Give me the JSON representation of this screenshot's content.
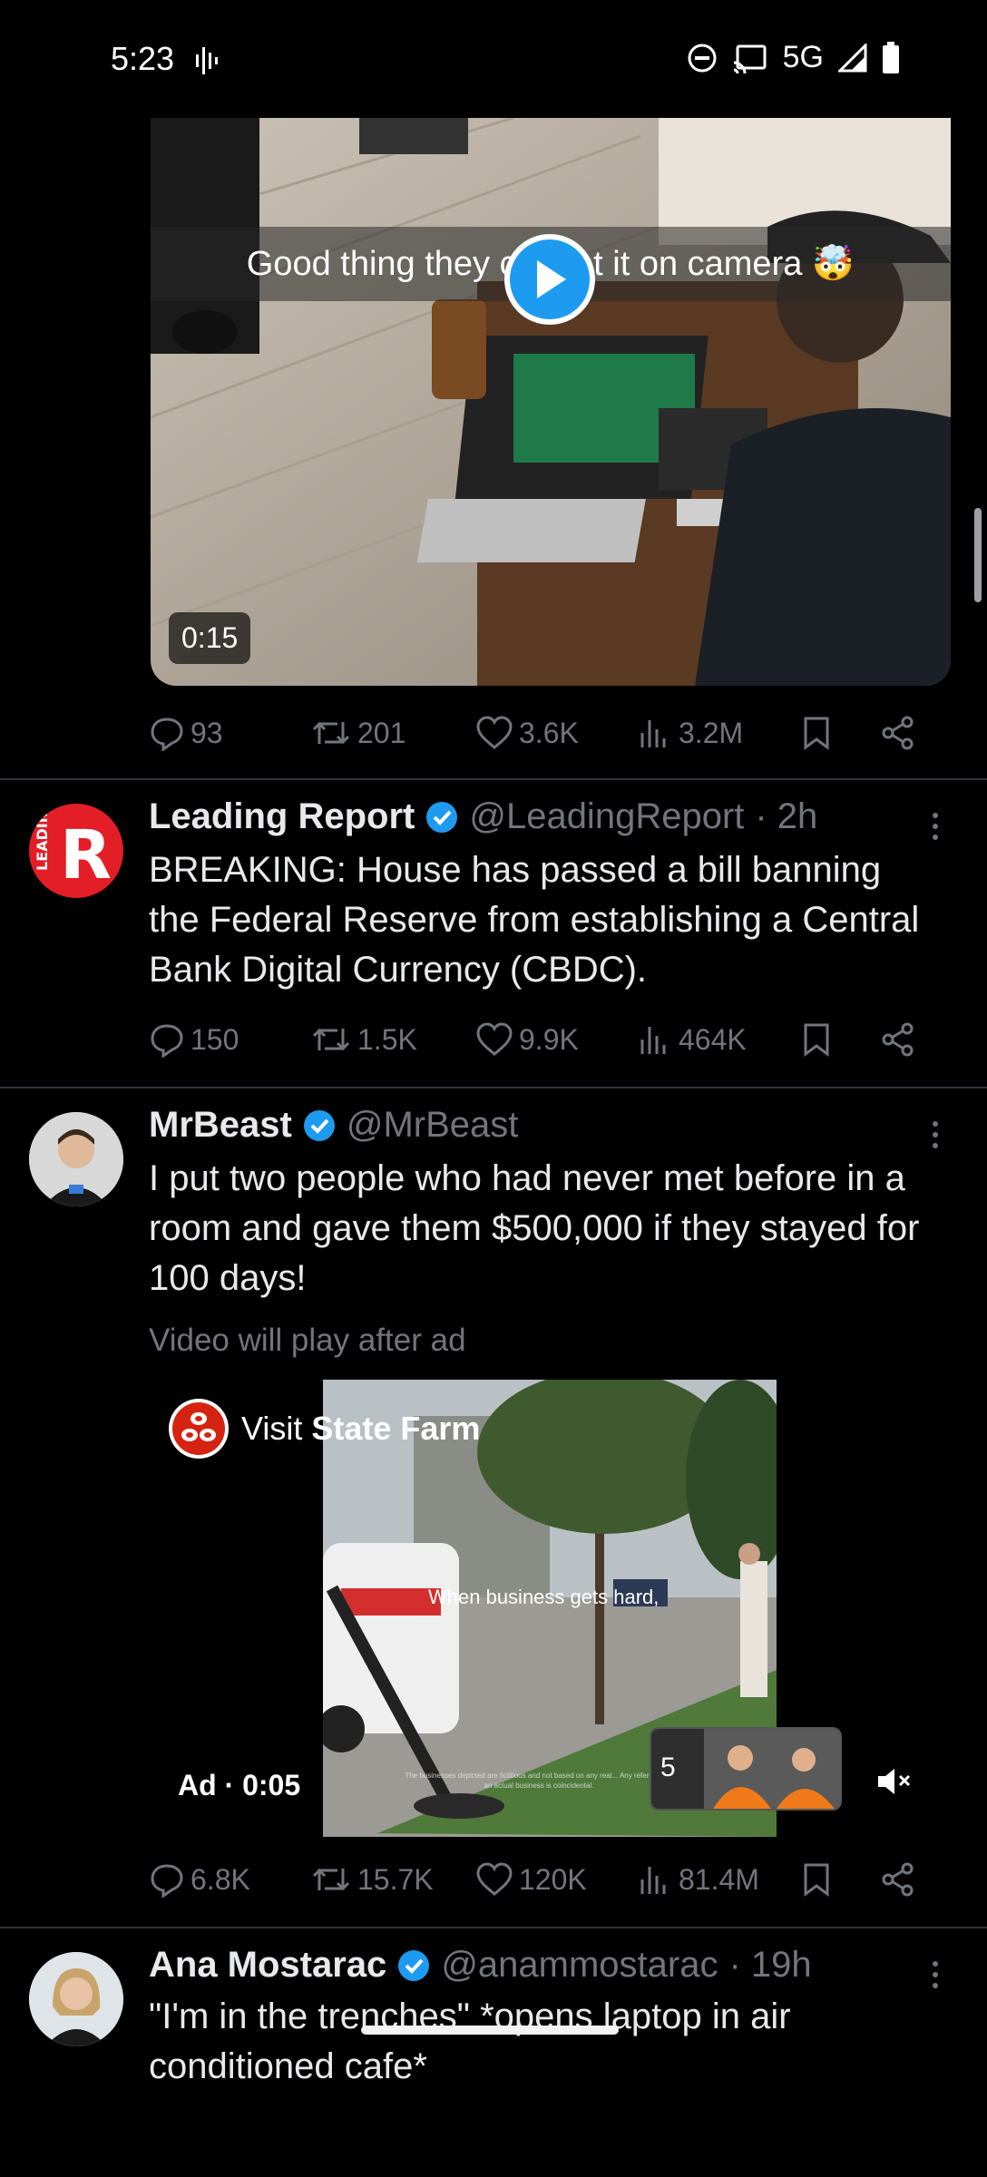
{
  "status_bar": {
    "time": "5:23",
    "network": "5G"
  },
  "tweet1": {
    "video_caption": "Good thing they caught it on camera 🤯",
    "duration": "0:15",
    "replies": "93",
    "retweets": "201",
    "likes": "3.6K",
    "views": "3.2M"
  },
  "tweet2": {
    "display_name": "Leading Report",
    "handle": "@LeadingReport",
    "time": "· 2h",
    "avatar_letter": "R",
    "avatar_side_text": "LEADING",
    "text": "BREAKING: House has passed a bill banning the Federal Reserve from establishing a Central Bank Digital Currency (CBDC).",
    "replies": "150",
    "retweets": "1.5K",
    "likes": "9.9K",
    "views": "464K"
  },
  "tweet3": {
    "display_name": "MrBeast",
    "handle": "@MrBeast",
    "text": "I put two people who had never met before in a room and gave them $500,000 if they stayed for 100 days!",
    "notice": "Video will play after ad",
    "ad_cta_prefix": "Visit ",
    "ad_cta_brand": "State Farm",
    "ad_caption": "When business gets hard,",
    "ad_fineprint": "The businesses depicted are fictitious and not based on any real... Any reference to an actual business is coincidental.",
    "ad_timer": "Ad · 0:05",
    "skip_countdown": "5",
    "replies": "6.8K",
    "retweets": "15.7K",
    "likes": "120K",
    "views": "81.4M"
  },
  "tweet4": {
    "display_name": "Ana Mostarac",
    "handle": "@anammostarac",
    "time": "· 19h",
    "text": "\"I'm in the trenches\" *opens laptop in air conditioned cafe*"
  },
  "colors": {
    "background": "#000000",
    "accent": "#1d9bf0",
    "muted": "#71767b",
    "divider": "#2f3336",
    "leading_red": "#e41e26"
  }
}
